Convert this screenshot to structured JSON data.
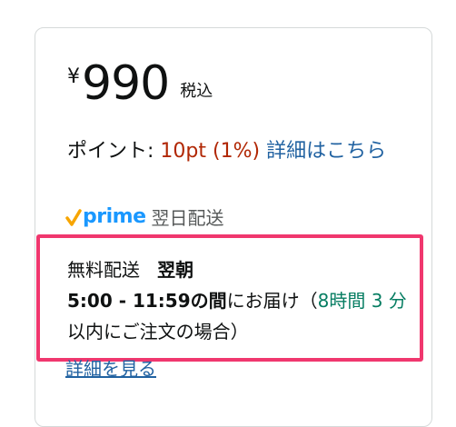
{
  "price": {
    "currency": "¥",
    "amount": "990",
    "tax_label": "税込"
  },
  "points": {
    "label": "ポイント:",
    "value": "10pt",
    "percent": "(1%)",
    "link": "詳細はこちら"
  },
  "prime": {
    "brand": "prime",
    "text": "翌日配送"
  },
  "delivery": {
    "label": "無料配送",
    "day": "翌朝",
    "time": "5:00 - 11:59の間",
    "text1": "にお届け（",
    "countdown": "8時間 3 分",
    "text2": "以内にご注文の場合）"
  },
  "details_link": "詳細を見る",
  "colors": {
    "highlight_border": "#f0376e",
    "price_red": "#b12704",
    "link_blue": "#2162a1",
    "countdown_green": "#067d62",
    "prime_blue": "#1a98ff",
    "prime_check": "#f7a500"
  }
}
